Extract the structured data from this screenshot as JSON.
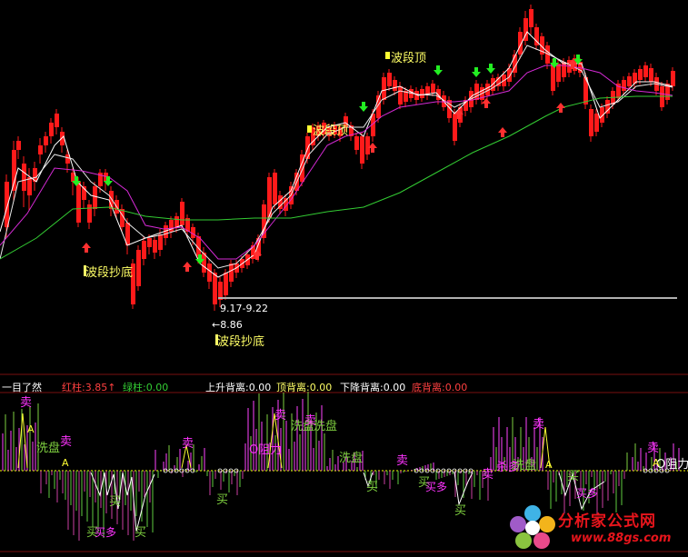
{
  "upper_panel": {
    "annotations": {
      "bottom_label_1": "波段抄底",
      "bottom_label_2": "波段抄底",
      "top_label_1": "波段顶",
      "top_label_2": "波段顶",
      "date_range": "9.17-9.22",
      "low_price": "←8.86"
    }
  },
  "indicator_header": {
    "name": "一目了然",
    "red_bar": "红柱:3.85↑",
    "green_bar": "绿柱:0.00",
    "rise_divergence": "上升背离:0.00",
    "top_divergence": "顶背离:0.00",
    "fall_divergence": "下降背离:0.00",
    "bottom_divergence": "底背离:0.00"
  },
  "lower_panel": {
    "signals": {
      "sell": "卖",
      "buy": "买",
      "wash": "洗盘",
      "resistance": "O阻力",
      "resistance_2": "O阻力",
      "buy_more": "买多",
      "short_sell": "杀多",
      "A": "A"
    }
  },
  "watermark": {
    "title": "分析家公式网",
    "url": "www.88gs.com"
  },
  "colors": {
    "up_candle": "#ff1a1a",
    "down_candle": "#1fa51f",
    "white_line": "#ffffff",
    "magenta_line": "#d42ad4",
    "green_line": "#33cc33",
    "support_line": "#b0b0b0",
    "label_yellow": "#ffff66"
  }
}
